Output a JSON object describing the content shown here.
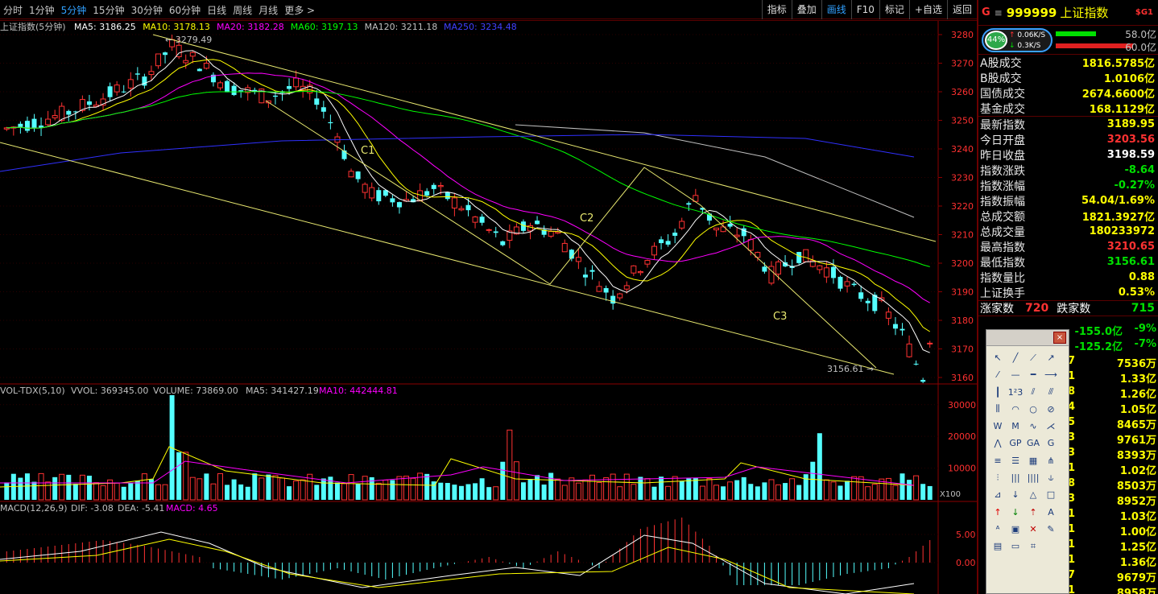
{
  "toolbar": {
    "periods": [
      "分时",
      "1分钟",
      "5分钟",
      "15分钟",
      "30分钟",
      "60分钟",
      "日线",
      "周线",
      "月线",
      "更多 >"
    ],
    "active_period": "5分钟",
    "tools": [
      "指标",
      "叠加",
      "画线",
      "F10",
      "标记",
      "+自选",
      "返回"
    ],
    "active_tool": "画线"
  },
  "main": {
    "title": "上证指数(5分钟)",
    "ma": [
      {
        "label": "MA5: 3186.25",
        "color": "#ffffff"
      },
      {
        "label": "MA10: 3178.13",
        "color": "#ffff00"
      },
      {
        "label": "MA20: 3182.28",
        "color": "#ff00ff"
      },
      {
        "label": "MA60: 3197.13",
        "color": "#00ff00"
      },
      {
        "label": "MA120: 3211.18",
        "color": "#c0c0c0"
      },
      {
        "label": "MA250: 3234.48",
        "color": "#4040ff"
      }
    ],
    "price_axis": [
      "3280",
      "3270",
      "3260",
      "3250",
      "3240",
      "3230",
      "3220",
      "3210",
      "3200",
      "3190",
      "3180",
      "3170",
      "3160"
    ],
    "annotations": {
      "high": "3279.49",
      "low": "3156.61",
      "c1": "C1",
      "c2": "C2",
      "c3": "C3"
    }
  },
  "volume": {
    "title": "VOL-TDX(5,10)",
    "vvol": "VVOL: 369345.00",
    "volume": "VOLUME: 73869.00",
    "ma5": "MA5: 341427.19",
    "ma10": "MA10: 442444.81",
    "axis": [
      "30000",
      "20000",
      "10000"
    ],
    "unit": "X100"
  },
  "macd": {
    "title": "MACD(12,26,9)",
    "dif": "DIF: -3.08",
    "dea": "DEA: -5.41",
    "macd": "MACD: 4.65",
    "axis": [
      "5.00",
      "0.00"
    ]
  },
  "quote": {
    "g": "G",
    "menu": "≡",
    "code": "999999",
    "name": "上证指数",
    "sg": "$G1",
    "gauge": {
      "pct": "44%",
      "up": "0.06K/S",
      "down": "0.3K/S",
      "up_amt": "58.0亿",
      "down_amt": "60.0亿"
    },
    "rows1": [
      {
        "l": "A股成交",
        "v": "1816.5785亿",
        "c": "y"
      },
      {
        "l": "B股成交",
        "v": "1.0106亿",
        "c": "y"
      },
      {
        "l": "国债成交",
        "v": "2674.6600亿",
        "c": "y"
      },
      {
        "l": "基金成交",
        "v": "168.1129亿",
        "c": "y"
      }
    ],
    "rows2": [
      {
        "l": "最新指数",
        "v": "3189.95",
        "c": "y"
      },
      {
        "l": "今日开盘",
        "v": "3203.56",
        "c": "r"
      },
      {
        "l": "昨日收盘",
        "v": "3198.59",
        "c": "w"
      },
      {
        "l": "指数涨跌",
        "v": "-8.64",
        "c": "gr"
      },
      {
        "l": "指数涨幅",
        "v": "-0.27%",
        "c": "gr"
      },
      {
        "l": "指数振幅",
        "v": "54.04/1.69%",
        "c": "y"
      },
      {
        "l": "总成交额",
        "v": "1821.3927亿",
        "c": "y"
      },
      {
        "l": "总成交量",
        "v": "180233972",
        "c": "y"
      },
      {
        "l": "最高指数",
        "v": "3210.65",
        "c": "r"
      },
      {
        "l": "最低指数",
        "v": "3156.61",
        "c": "gr"
      },
      {
        "l": "指数量比",
        "v": "0.88",
        "c": "y"
      },
      {
        "l": "上证换手",
        "v": "0.53%",
        "c": "y"
      }
    ],
    "counts": {
      "up_label": "涨家数",
      "up": "720",
      "down_label": "跌家数",
      "down": "715"
    },
    "flows": [
      {
        "v": "-155.0亿",
        "p": "-9%"
      },
      {
        "v": "-125.2亿",
        "p": "-7%"
      }
    ],
    "list": [
      {
        "a": "7",
        "b": "7536万"
      },
      {
        "a": "1",
        "b": "1.33亿"
      },
      {
        "a": "8",
        "b": "1.26亿"
      },
      {
        "a": "4",
        "b": "1.05亿"
      },
      {
        "a": "5",
        "b": "8465万"
      },
      {
        "a": "3",
        "b": "9761万"
      },
      {
        "a": "3",
        "b": "8393万"
      },
      {
        "a": "1",
        "b": "1.02亿"
      },
      {
        "a": "8",
        "b": "8503万"
      },
      {
        "a": "3",
        "b": "8952万"
      },
      {
        "a": "1",
        "b": "1.03亿"
      },
      {
        "a": "1",
        "b": "1.00亿"
      },
      {
        "a": "1",
        "b": "1.25亿"
      },
      {
        "a": "1",
        "b": "1.36亿"
      },
      {
        "a": "7",
        "b": "9679万"
      },
      {
        "a": "1",
        "b": "8958万"
      }
    ]
  },
  "palette": {
    "close": "×",
    "tools": [
      "arrow-cursor",
      "line-segment",
      "straight-line",
      "ray",
      "dashed-line",
      "h-segment",
      "h-line",
      "h-ray",
      "vertical-line",
      "price-label",
      "parallel",
      "rising-parallel",
      "channel-line",
      "arc",
      "circle",
      "fib-circle",
      "w-wave",
      "m-wave",
      "wave-line",
      "ray-fan",
      "peak-line",
      "gap",
      "gap-a",
      "gap-g",
      "fib-levels",
      "fib-lines",
      "grid-lines",
      "pitchfork",
      "h-channel",
      "vert-lines",
      "time-zones",
      "trend-bars",
      "angle-fan",
      "down-arrow",
      "triangle",
      "rectangle",
      "up-arrow-red",
      "down-arrow-green",
      "price-marker",
      "text-a",
      "text-tool",
      "box",
      "delete",
      "brush",
      "note",
      "ruler",
      "screenshot"
    ],
    "text_a": "A"
  }
}
